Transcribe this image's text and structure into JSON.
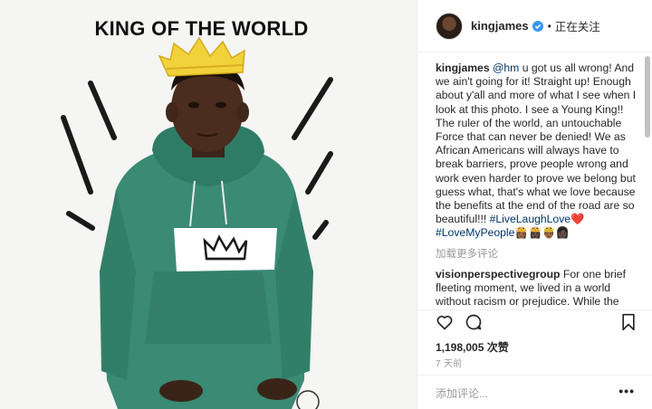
{
  "photo": {
    "title": "KING OF THE WORLD"
  },
  "post": {
    "username": "kingjames",
    "verified": true,
    "follow_state": "正在关注",
    "separator": "•",
    "caption": {
      "username": "kingjames",
      "mention": "@hm",
      "text": " u got us all wrong! And we ain't going for it! Straight up! Enough about y'all and more of what I see when I look at this photo. I see a Young King!! The ruler of the world, an untouchable Force that can never be denied! We as African Americans will always have to break barriers, prove people wrong and work even harder to prove we belong but guess what, that's what we love because the benefits at the end of the road are so beautiful!!! ",
      "hashtag1": "#LiveLaughLove",
      "emoji1": "❤️",
      "hashtag2": "#LoveMyPeople",
      "emoji2": "👸🏾👸🏿🤴🏾👩🏿"
    },
    "load_more": "加载更多评论",
    "comment": {
      "username": "visionperspectivegroup",
      "text": " For one brief fleeting moment, we lived in a world without racism or prejudice. While the battle against discrimination must never cease, for one brief moment, a"
    },
    "likes": "1,198,005 次赞",
    "time": "7 天前",
    "add_comment_placeholder": "添加评论...",
    "more": "•••"
  },
  "icons": {
    "like": "heart-icon",
    "comment": "comment-icon",
    "save": "bookmark-icon",
    "verified": "verified-badge-icon"
  },
  "colors": {
    "hoodie": "#3a8a74",
    "crown": "#f2d23a",
    "verified": "#3897f0",
    "hashtag": "#003569"
  }
}
